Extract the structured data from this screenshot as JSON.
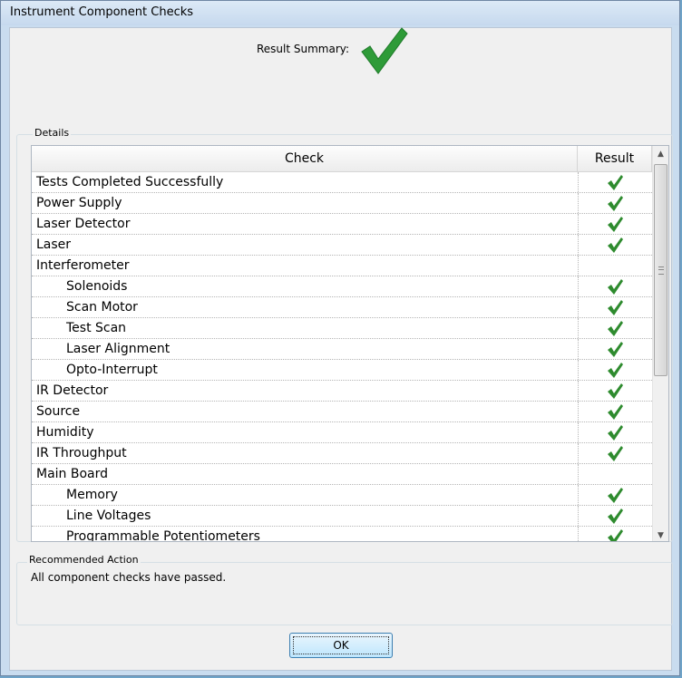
{
  "window": {
    "title": "Instrument Component Checks"
  },
  "summary": {
    "label": "Result Summary:",
    "status_icon": "green-checkmark-icon"
  },
  "details": {
    "label": "Details",
    "columns": [
      "Check",
      "Result"
    ],
    "rows": [
      {
        "check": "Tests Completed Successfully",
        "indent": false,
        "passed": true
      },
      {
        "check": "Power Supply",
        "indent": false,
        "passed": true
      },
      {
        "check": "Laser Detector",
        "indent": false,
        "passed": true
      },
      {
        "check": "Laser",
        "indent": false,
        "passed": true
      },
      {
        "check": "Interferometer",
        "indent": false,
        "passed": false
      },
      {
        "check": "Solenoids",
        "indent": true,
        "passed": true
      },
      {
        "check": "Scan Motor",
        "indent": true,
        "passed": true
      },
      {
        "check": "Test Scan",
        "indent": true,
        "passed": true
      },
      {
        "check": "Laser Alignment",
        "indent": true,
        "passed": true
      },
      {
        "check": "Opto-Interrupt",
        "indent": true,
        "passed": true
      },
      {
        "check": "IR Detector",
        "indent": false,
        "passed": true
      },
      {
        "check": "Source",
        "indent": false,
        "passed": true
      },
      {
        "check": "Humidity",
        "indent": false,
        "passed": true
      },
      {
        "check": "IR Throughput",
        "indent": false,
        "passed": true
      },
      {
        "check": "Main Board",
        "indent": false,
        "passed": false
      },
      {
        "check": "Memory",
        "indent": true,
        "passed": true
      },
      {
        "check": "Line Voltages",
        "indent": true,
        "passed": true
      },
      {
        "check": "Programmable Potentiometers",
        "indent": true,
        "passed": true
      }
    ]
  },
  "recommended": {
    "label": "Recommended Action",
    "text": "All component checks have passed."
  },
  "buttons": {
    "ok": "OK"
  },
  "colors": {
    "check_green": "#2e8b2e",
    "window_frame": "#c9dcef"
  }
}
